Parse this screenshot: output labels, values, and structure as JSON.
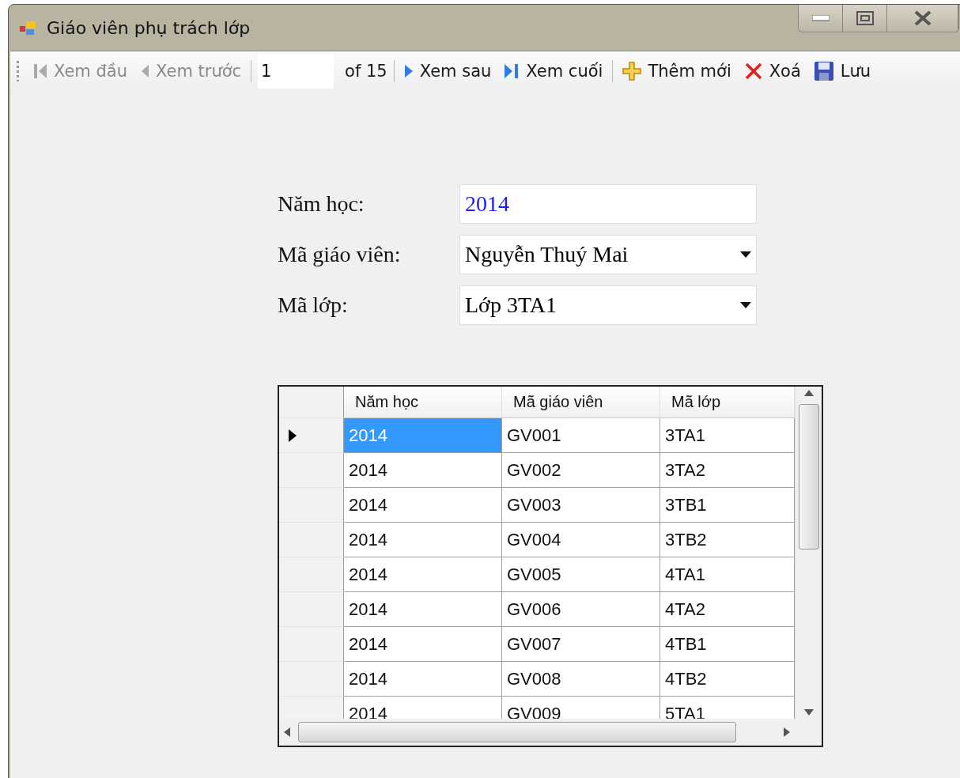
{
  "window": {
    "title": "Giáo viên phụ trách lớp"
  },
  "toolbar": {
    "items": [
      {
        "kind": "first",
        "label": "Xem đầu",
        "disabled": true
      },
      {
        "kind": "prev",
        "label": "Xem trước",
        "disabled": true
      },
      {
        "kind": "separator"
      },
      {
        "kind": "position",
        "value": "1",
        "suffix": "of 15"
      },
      {
        "kind": "separator"
      },
      {
        "kind": "next",
        "label": "Xem sau",
        "disabled": false
      },
      {
        "kind": "last",
        "label": "Xem cuối",
        "disabled": false
      },
      {
        "kind": "separator"
      },
      {
        "kind": "add",
        "label": "Thêm mới",
        "disabled": false
      },
      {
        "kind": "delete",
        "label": "Xoá",
        "disabled": false
      },
      {
        "kind": "save",
        "label": "Lưu",
        "disabled": false
      }
    ]
  },
  "form": {
    "fields": [
      {
        "kind": "text",
        "label": "Năm học:",
        "value": "2014"
      },
      {
        "kind": "dropdown",
        "label": "Mã giáo viên:",
        "value": "Nguyễn Thuý Mai"
      },
      {
        "kind": "dropdown",
        "label": "Mã lớp:",
        "value": "Lớp 3TA1"
      }
    ]
  },
  "table": {
    "columns": [
      "Năm học",
      "Mã giáo viên",
      "Mã lớp"
    ],
    "rows": [
      {
        "cells": [
          "2014",
          "GV001",
          "3TA1"
        ],
        "selected": true
      },
      {
        "cells": [
          "2014",
          "GV002",
          "3TA2"
        ],
        "selected": false
      },
      {
        "cells": [
          "2014",
          "GV003",
          "3TB1"
        ],
        "selected": false
      },
      {
        "cells": [
          "2014",
          "GV004",
          "3TB2"
        ],
        "selected": false
      },
      {
        "cells": [
          "2014",
          "GV005",
          "4TA1"
        ],
        "selected": false
      },
      {
        "cells": [
          "2014",
          "GV006",
          "4TA2"
        ],
        "selected": false
      },
      {
        "cells": [
          "2014",
          "GV007",
          "4TB1"
        ],
        "selected": false
      },
      {
        "cells": [
          "2014",
          "GV008",
          "4TB2"
        ],
        "selected": false
      },
      {
        "cells": [
          "2014",
          "GV009",
          "5TA1"
        ],
        "selected": false
      }
    ]
  }
}
